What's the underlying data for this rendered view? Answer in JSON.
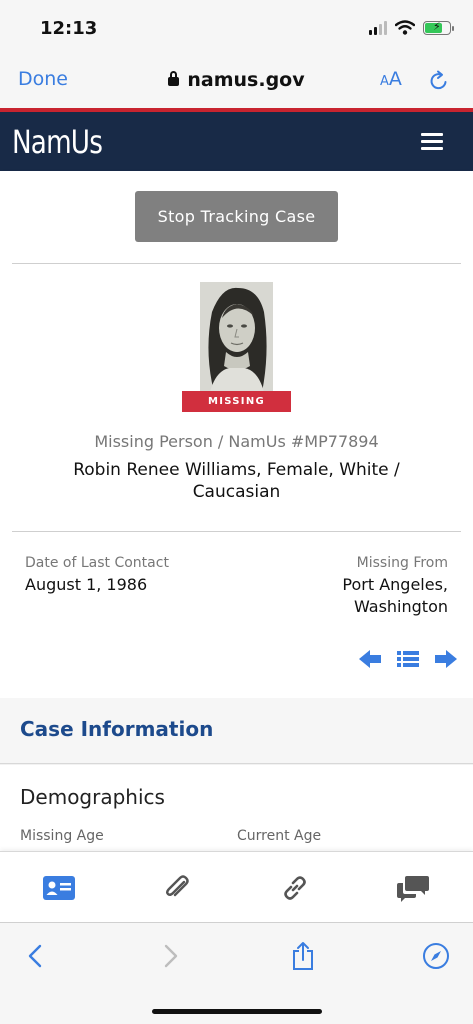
{
  "status_bar": {
    "time": "12:13"
  },
  "browser": {
    "done_label": "Done",
    "url": "namus.gov",
    "text_size_label_small": "A",
    "text_size_label_large": "A"
  },
  "site": {
    "logo": "NamUs"
  },
  "case": {
    "stop_tracking_label": "Stop Tracking Case",
    "status_badge": "MISSING",
    "case_number": "Missing Person / NamUs #MP77894",
    "person_name": "Robin Renee Williams, Female, White / Caucasian",
    "last_contact_label": "Date of Last Contact",
    "last_contact_value": "August 1, 1986",
    "missing_from_label": "Missing From",
    "missing_from_value": "Port Angeles, Washington"
  },
  "case_information": {
    "title": "Case Information",
    "demographics_title": "Demographics",
    "missing_age_label": "Missing Age",
    "current_age_label": "Current Age"
  },
  "colors": {
    "accent": "#3a7de0",
    "header_bg": "#182a47",
    "badge_red": "#d12f3e",
    "link_blue": "#1d4a8c"
  },
  "icons": {
    "tab_bar": [
      "id-card-icon",
      "paperclip-icon",
      "link-icon",
      "chat-bubbles-icon"
    ],
    "browser_bottom": [
      "back-icon",
      "forward-icon",
      "share-icon",
      "compass-icon"
    ]
  }
}
